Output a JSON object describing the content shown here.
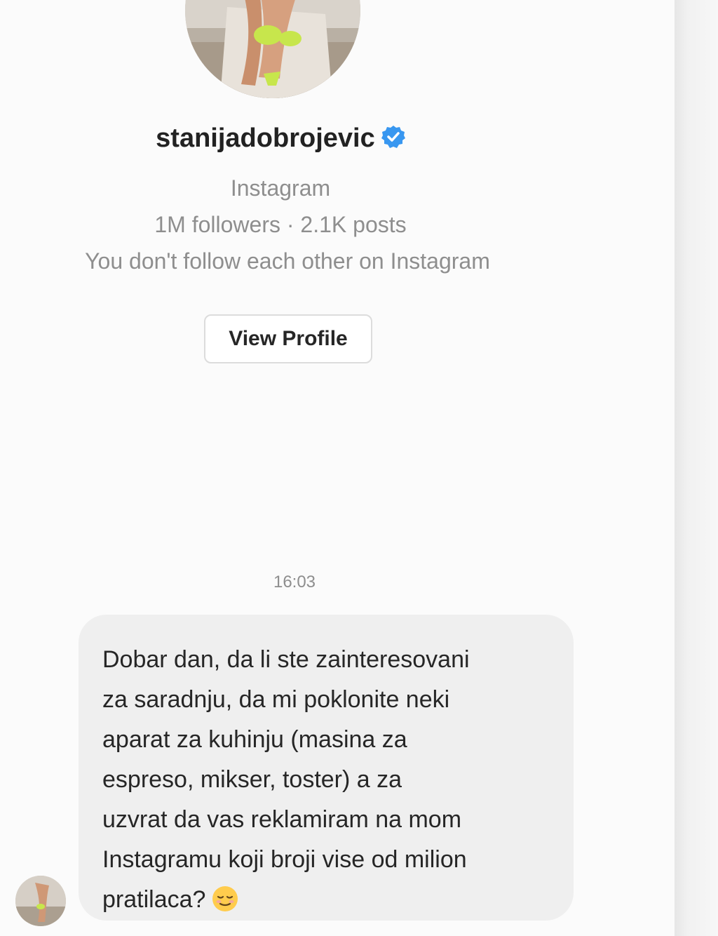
{
  "profile": {
    "username": "stanijadobrojevic",
    "platform": "Instagram",
    "stats": "1M followers · 2.1K posts",
    "follow_status": "You don't follow each other on Instagram",
    "view_profile_label": "View Profile",
    "verified_color": "#3897f0"
  },
  "conversation": {
    "timestamp": "16:03",
    "message_lines": [
      "Dobar dan, da li ste zainteresovani",
      "za saradnju, da mi poklonite neki",
      "aparat za kuhinju (masina za",
      "espreso, mikser, toster) a za",
      "uzvrat da vas reklamiram na mom",
      "Instagramu koji broji vise od milion",
      "pratilaca?"
    ],
    "message_emoji": "relieved-face-emoji",
    "bubble_color": "#efefef"
  }
}
